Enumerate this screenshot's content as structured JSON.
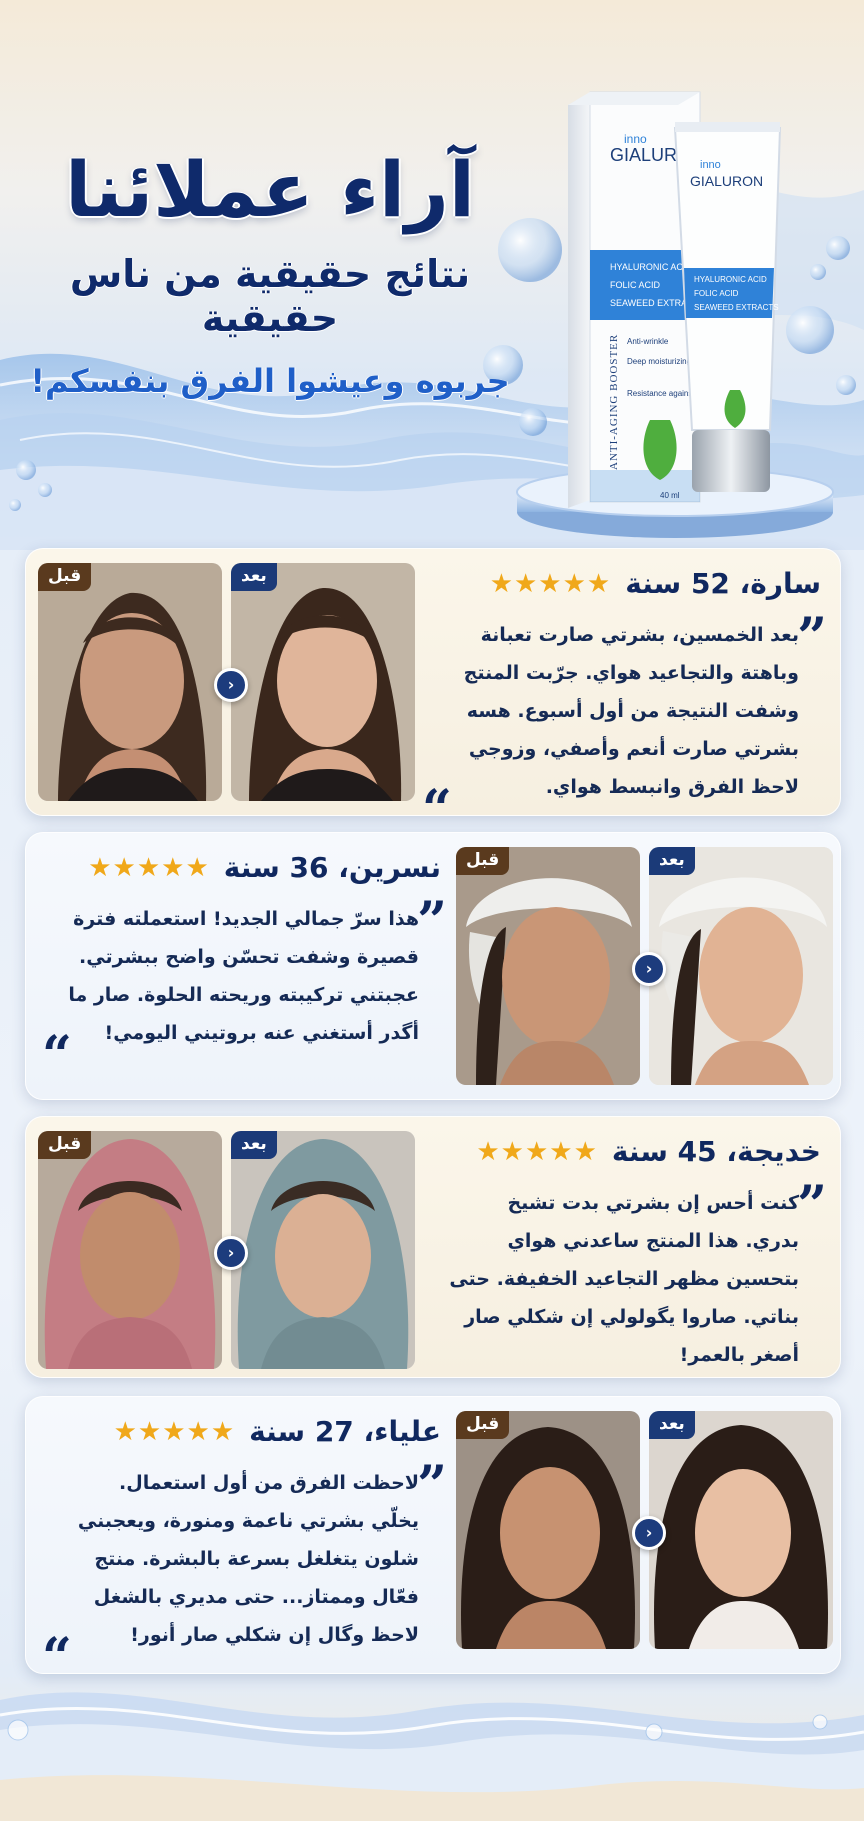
{
  "hero": {
    "title": "آراء عملائنا",
    "subtitle": "نتائج حقيقية من ناس حقيقية",
    "tagline": "جربوه وعيشوا الفرق بنفسكم!"
  },
  "product": {
    "brand_small": "inno",
    "brand": "GIALURON",
    "ingredients": [
      "HYALURONIC ACID",
      "FOLIC ACID",
      "SEAWEED EXTRACTS"
    ],
    "benefits": [
      "Anti-wrinkle",
      "Deep moisturizing",
      "Resistance against UV"
    ],
    "box_side": "ANTI-AGING BOOSTER",
    "volume": "40 ml"
  },
  "labels": {
    "before": "قبل",
    "after": "بعد"
  },
  "colors": {
    "navy": "#10285f",
    "star": "#f0a81a",
    "accent_blue": "#1f5fc8",
    "before_badge": "#5a3a1e",
    "after_badge": "#1b3a78"
  },
  "reviews": [
    {
      "name": "سارة، 52 سنة",
      "stars": "★★★★★",
      "rating": 5,
      "text": "بعد الخمسين، بشرتي صارت تعبانة وباهتة والتجاعيد هواي. جرّبت المنتج وشفت النتيجة من أول أسبوع. هسه بشرتي صارت أنعم وأصفي، وزوجي لاحظ الفرق وانبسط هواي."
    },
    {
      "name": "نسرين، 36 سنة",
      "stars": "★★★★★",
      "rating": 5,
      "text": "هذا سرّ جمالي الجديد! استعملته فترة قصيرة وشفت تحسّن واضح ببشرتي. عجبتني تركيبته وريحته الحلوة. صار ما أگدر أستغني عنه بروتيني اليومي!"
    },
    {
      "name": "خديجة، 45 سنة",
      "stars": "★★★★★",
      "rating": 5,
      "text": "كنت أحس إن بشرتي بدت تشيخ بدري. هذا المنتج ساعدني هواي بتحسين مظهر التجاعيد الخفيفة. حتى بناتي. صاروا يگولولي إن شكلي صار أصغر بالعمر!"
    },
    {
      "name": "علياء، 27 سنة",
      "stars": "★★★★★",
      "rating": 5,
      "text": "لاحظت الفرق من أول استعمال. يخلّي بشرتي ناعمة ومنورة، ويعجبني شلون يتغلغل بسرعة بالبشرة. منتج فعّال وممتاز... حتى مديري بالشغل لاحظ وگال إن شكلي صار أنور!"
    }
  ]
}
